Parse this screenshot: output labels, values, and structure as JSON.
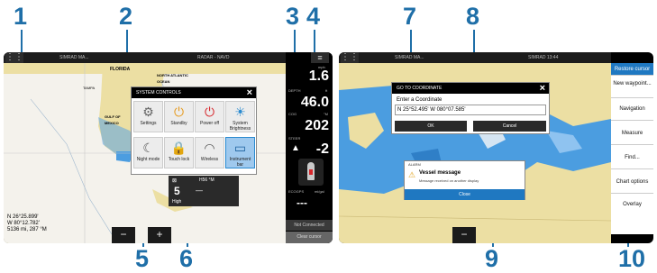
{
  "callouts": {
    "c1": "1",
    "c2": "2",
    "c3": "3",
    "c4": "4",
    "c5": "5",
    "c6": "6",
    "c7": "7",
    "c8": "8",
    "c9": "9",
    "c10": "10"
  },
  "left_screen": {
    "topbar": {
      "left": "SIMRAD MA...",
      "right": "RADAR - NAVD"
    },
    "map_labels": {
      "florida": "FLORIDA",
      "north_atlantic": "NORTH ATLANTIC OCEAN",
      "tampa": "TAMPA",
      "gulf_of_mexico": "GULF OF MEXICO"
    },
    "coords": {
      "lat": "N 26°25.899'",
      "lon": "W 80°12.782'",
      "range": "5136 mi, 287 °M"
    },
    "zoom_out": "−",
    "zoom_in": "+",
    "system_controls": {
      "title": "SYSTEM CONTROLS",
      "close": "×",
      "tiles": [
        {
          "icon": "⚙",
          "label": "Settings"
        },
        {
          "icon": "⏻",
          "label": "Standby"
        },
        {
          "icon": "⏻",
          "label": "Power off"
        },
        {
          "icon": "☀",
          "label": "System Brightness"
        },
        {
          "icon": "☾",
          "label": "Night mode"
        },
        {
          "icon": "🔒",
          "label": "Touch lock"
        },
        {
          "icon": "◠",
          "label": "Wireless"
        },
        {
          "icon": "▭",
          "label": "Instrument bar"
        }
      ]
    },
    "popup": {
      "label": "H56 °M",
      "value": "5",
      "sub": "—",
      "footer": "High"
    },
    "instruments": {
      "speed_unit": "mph",
      "speed": "1.6",
      "depth_label": "DEPTH",
      "depth_unit": "ft",
      "depth": "46.0",
      "cog_label": "COG",
      "cog_unit": "°M",
      "cog": "202",
      "steer_label": "STEER",
      "steer": "-2",
      "ecogps_label": "ECOGPS",
      "ecogps_unit": "mi/gal",
      "ecogps": "---",
      "not_connected": "Not Connected",
      "clear_cursor": "Clear cursor"
    }
  },
  "right_screen": {
    "topbar": {
      "left": "SIMRAD MA...",
      "right": "SIMRAD  13:44"
    },
    "goto_dialog": {
      "title": "GO TO COORDINATE",
      "prompt": "Enter a Coordinate",
      "value": "N 25°52.495'  W 080°07.585'",
      "ok": "OK",
      "cancel": "Cancel",
      "close": "×"
    },
    "alarm": {
      "title": "ALARM",
      "message": "Vessel message",
      "sub": "Message received on another display",
      "close": "Close"
    },
    "zoom_out": "−",
    "cursor_menu": [
      "Restore cursor",
      "New waypoint...",
      "Navigation",
      "Measure",
      "Find...",
      "Chart options",
      "Overlay"
    ]
  },
  "colors": {
    "callout": "#1f6fa8",
    "land": "#ecdfa3",
    "water": "#4b9de0",
    "panel": "#000000"
  }
}
